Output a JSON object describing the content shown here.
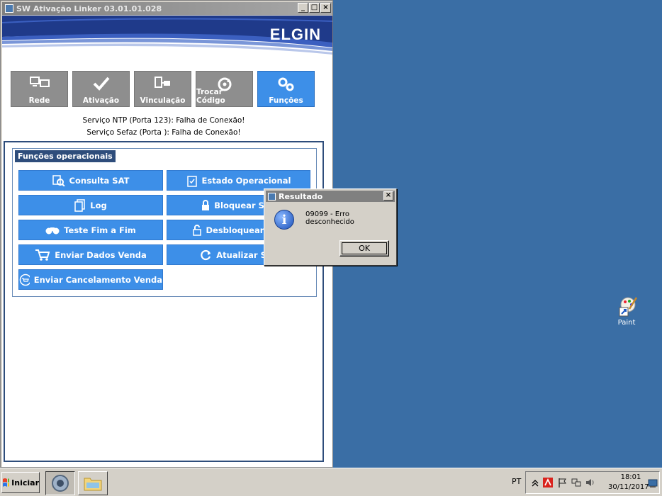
{
  "window": {
    "title": "SW Ativação Linker 03.01.01.028",
    "min_label": "_",
    "max_label": "□",
    "close_label": "×",
    "brand": "ELGIN"
  },
  "tabs": [
    {
      "label": "Rede",
      "icon": "network-icon",
      "active": false
    },
    {
      "label": "Ativação",
      "icon": "check-icon",
      "active": false
    },
    {
      "label": "Vinculação",
      "icon": "link-icon",
      "active": false
    },
    {
      "label": "Trocar Código",
      "icon": "refresh-code-icon",
      "active": false
    },
    {
      "label": "Funções",
      "icon": "gears-icon",
      "active": true
    }
  ],
  "status": {
    "ntp": "Serviço NTP (Porta 123): Falha de Conexão!",
    "sefaz": "Serviço Sefaz  (Porta ): Falha de Conexão!"
  },
  "functions": {
    "legend": "Funções operacionais",
    "buttons": [
      {
        "label": "Consulta SAT",
        "icon": "search-icon"
      },
      {
        "label": "Estado Operacional",
        "icon": "clipboard-icon"
      },
      {
        "label": "Log",
        "icon": "document-icon"
      },
      {
        "label": "Bloquear SAT",
        "icon": "lock-icon"
      },
      {
        "label": "Teste Fim a Fim",
        "icon": "binoculars-icon"
      },
      {
        "label": "Desbloquear SAT",
        "icon": "unlock-icon"
      },
      {
        "label": "Enviar Dados Venda",
        "icon": "cart-icon"
      },
      {
        "label": "Atualizar SAT",
        "icon": "refresh-icon"
      },
      {
        "label": "Enviar Cancelamento Venda",
        "icon": "cancel-sale-icon"
      }
    ]
  },
  "dialog": {
    "title": "Resultado",
    "close_label": "×",
    "icon_glyph": "i",
    "message": "09099 - Erro desconhecido",
    "ok_label": "OK"
  },
  "desktop": {
    "paint_label": "Paint"
  },
  "taskbar": {
    "start_label": "Iniciar",
    "language": "PT",
    "time": "18:01",
    "date": "30/11/2017"
  },
  "colors": {
    "desktop": "#3a6ea5",
    "accent_button": "#3d8fe8",
    "tab_inactive": "#8e8e8e",
    "panel_border": "#2e4d7b"
  }
}
